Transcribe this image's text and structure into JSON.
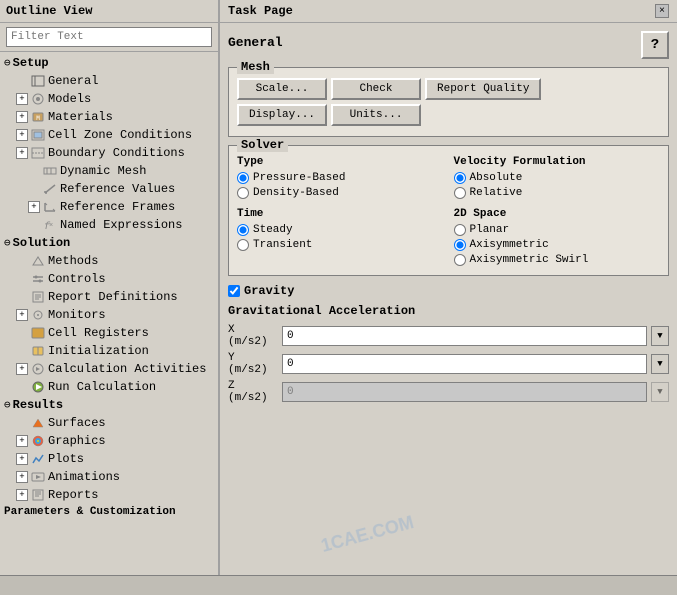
{
  "outlinePanel": {
    "title": "Outline View",
    "filter": {
      "placeholder": "Filter Text"
    },
    "tree": [
      {
        "level": 0,
        "type": "section",
        "expand": "minus",
        "label": "Setup"
      },
      {
        "level": 1,
        "type": "leaf",
        "icon": "gear",
        "label": "General"
      },
      {
        "level": 1,
        "type": "expand-plus",
        "icon": "models",
        "label": "Models"
      },
      {
        "level": 1,
        "type": "expand-plus",
        "icon": "materials",
        "label": "Materials"
      },
      {
        "level": 1,
        "type": "expand-plus",
        "icon": "cell-zone",
        "label": "Cell Zone Conditions"
      },
      {
        "level": 1,
        "type": "expand-plus",
        "icon": "boundary",
        "label": "Boundary Conditions"
      },
      {
        "level": 2,
        "type": "leaf",
        "icon": "dynamic-mesh",
        "label": "Dynamic Mesh"
      },
      {
        "level": 2,
        "type": "leaf",
        "icon": "ref-values",
        "label": "Reference Values"
      },
      {
        "level": 2,
        "type": "expand-plus",
        "icon": "ref-frames",
        "label": "Reference Frames"
      },
      {
        "level": 2,
        "type": "leaf",
        "icon": "named-expr",
        "label": "Named Expressions"
      },
      {
        "level": 0,
        "type": "section",
        "expand": "minus",
        "label": "Solution"
      },
      {
        "level": 1,
        "type": "leaf",
        "icon": "methods",
        "label": "Methods"
      },
      {
        "level": 1,
        "type": "leaf",
        "icon": "controls",
        "label": "Controls"
      },
      {
        "level": 1,
        "type": "leaf",
        "icon": "report-def",
        "label": "Report Definitions"
      },
      {
        "level": 1,
        "type": "expand-plus",
        "icon": "monitors",
        "label": "Monitors"
      },
      {
        "level": 1,
        "type": "leaf",
        "icon": "cell-reg",
        "label": "Cell Registers"
      },
      {
        "level": 1,
        "type": "leaf",
        "icon": "init",
        "label": "Initialization"
      },
      {
        "level": 1,
        "type": "expand-plus",
        "icon": "calc-act",
        "label": "Calculation Activities"
      },
      {
        "level": 1,
        "type": "leaf",
        "icon": "run-calc",
        "label": "Run Calculation"
      },
      {
        "level": 0,
        "type": "section",
        "expand": "minus",
        "label": "Results"
      },
      {
        "level": 1,
        "type": "leaf",
        "icon": "surfaces",
        "label": "Surfaces"
      },
      {
        "level": 1,
        "type": "expand-plus",
        "icon": "graphics",
        "label": "Graphics"
      },
      {
        "level": 1,
        "type": "expand-plus",
        "icon": "plots",
        "label": "Plots"
      },
      {
        "level": 1,
        "type": "expand-plus",
        "icon": "animations",
        "label": "Animations"
      },
      {
        "level": 1,
        "type": "expand-plus",
        "icon": "reports",
        "label": "Reports"
      },
      {
        "level": 0,
        "type": "section-last",
        "expand": null,
        "label": "Parameters & Customization"
      }
    ]
  },
  "taskPanel": {
    "title": "Task Page",
    "closeIcon": "×",
    "generalLabel": "General",
    "helpIcon": "?",
    "mesh": {
      "title": "Mesh",
      "buttons": [
        "Scale...",
        "Check",
        "Report Quality",
        "Display...",
        "Units..."
      ]
    },
    "solver": {
      "title": "Solver",
      "type": {
        "label": "Type",
        "options": [
          {
            "label": "Pressure-Based",
            "selected": true
          },
          {
            "label": "Density-Based",
            "selected": false
          }
        ]
      },
      "velocity": {
        "label": "Velocity Formulation",
        "options": [
          {
            "label": "Absolute",
            "selected": true
          },
          {
            "label": "Relative",
            "selected": false
          }
        ]
      }
    },
    "time": {
      "label": "Time",
      "options": [
        {
          "label": "Steady",
          "selected": true
        },
        {
          "label": "Transient",
          "selected": false
        }
      ]
    },
    "space2d": {
      "label": "2D Space",
      "options": [
        {
          "label": "Planar",
          "selected": false
        },
        {
          "label": "Axisymmetric",
          "selected": true
        },
        {
          "label": "Axisymmetric Swirl",
          "selected": false
        }
      ]
    },
    "gravity": {
      "checkLabel": "Gravity",
      "checked": true,
      "accelTitle": "Gravitational Acceleration",
      "axes": [
        {
          "label": "X (m/s2)",
          "value": "0",
          "enabled": true
        },
        {
          "label": "Y (m/s2)",
          "value": "0",
          "enabled": true
        },
        {
          "label": "Z (m/s2)",
          "value": "0",
          "enabled": false
        }
      ]
    }
  },
  "watermark": "1CAE.COM",
  "colors": {
    "accent": "#4a90d9",
    "bg": "#d4d0c8",
    "groupBg": "#e8e4dc"
  }
}
